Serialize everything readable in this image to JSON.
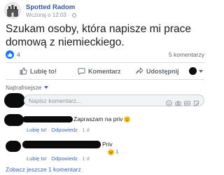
{
  "post": {
    "page_name": "Spotted Radom",
    "timestamp": "Wczoraj o 12:03 ·",
    "text": "Szukam osoby, która napisze mi prace domową z niemieckiego.",
    "reaction_count": "4",
    "comments_count": "5 komentarzy"
  },
  "actions": {
    "like": "Lubię to!",
    "comment": "Komentarz",
    "share": "Udostępnij"
  },
  "sort": {
    "label": "Najtrafniejsze"
  },
  "comment_box": {
    "placeholder": "Napisz komentarz..."
  },
  "comments": [
    {
      "text": "Zapraszam na priv",
      "like": "Lubię to!",
      "reply": "Odpowiedz",
      "time": "1 d"
    },
    {
      "text": "Priv",
      "reaction_count": "1",
      "like": "Lubię to!",
      "reply": "Odpowiedz",
      "time": "1 d"
    }
  ],
  "more_comments": "Zobacz jeszcze 1 komentarz",
  "colors": {
    "link": "#365899",
    "like_blue": "#1877f2",
    "text": "#1c1e21",
    "muted": "#606770"
  }
}
